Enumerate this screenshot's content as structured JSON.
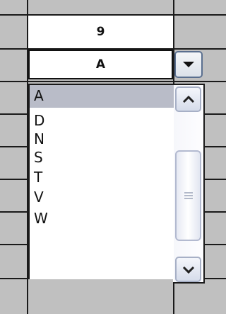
{
  "cells": {
    "header_value": "9",
    "selected_value": "A"
  },
  "dropdown": {
    "button_icon": "chevron-down-icon",
    "options": [
      "A",
      "D",
      "N",
      "S",
      "T",
      "V",
      "W"
    ],
    "selected_index": 0
  },
  "scrollbar": {
    "up_icon": "chevron-up-icon",
    "down_icon": "chevron-down-icon",
    "grip_icon": "grip-lines-icon"
  }
}
